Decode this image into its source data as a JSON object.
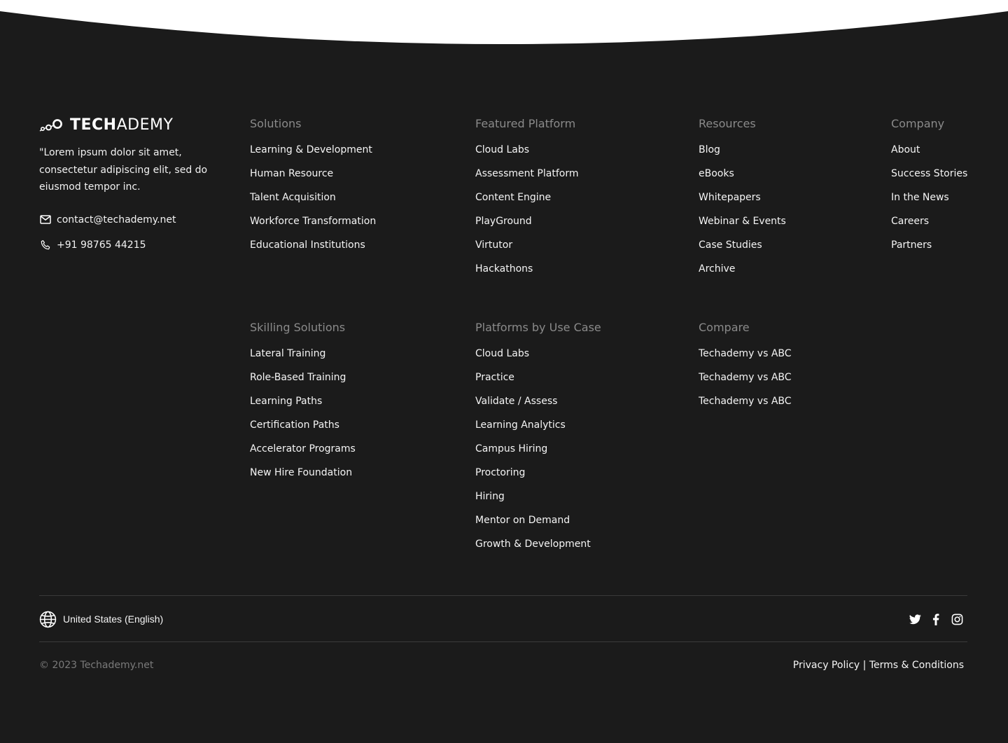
{
  "brand": {
    "logo_bold": "TECH",
    "logo_light": "ADEMY",
    "tagline": "\"Lorem ipsum dolor sit amet, consectetur adipiscing elit, sed do eiusmod tempor inc.",
    "email": "contact@techademy.net",
    "phone": "+91 98765 44215"
  },
  "columns": {
    "solutions": {
      "heading": "Solutions",
      "items": [
        "Learning & Development",
        "Human Resource",
        "Talent Acquisition",
        "Workforce Transformation",
        "Educational Institutions"
      ]
    },
    "featured_platform": {
      "heading": "Featured Platform",
      "items": [
        "Cloud Labs",
        "Assessment Platform",
        "Content Engine",
        "PlayGround",
        "Virtutor",
        "Hackathons"
      ]
    },
    "resources": {
      "heading": "Resources",
      "items": [
        "Blog",
        "eBooks",
        "Whitepapers",
        "Webinar & Events",
        "Case Studies",
        "Archive"
      ]
    },
    "company": {
      "heading": "Company",
      "items": [
        "About",
        "Success Stories",
        "In the News",
        "Careers",
        "Partners"
      ]
    },
    "skilling_solutions": {
      "heading": "Skilling Solutions",
      "items": [
        "Lateral Training",
        "Role-Based Training",
        "Learning Paths",
        "Certification Paths",
        "Accelerator Programs",
        "New Hire Foundation"
      ]
    },
    "platforms_by_use_case": {
      "heading": "Platforms by Use Case",
      "items": [
        "Cloud Labs",
        "Practice",
        "Validate / Assess",
        "Learning Analytics",
        "Campus Hiring",
        "Proctoring",
        "Hiring",
        "Mentor on Demand",
        "Growth & Development"
      ]
    },
    "compare": {
      "heading": "Compare",
      "items": [
        "Techademy vs ABC",
        "Techademy vs ABC",
        "Techademy vs ABC"
      ]
    }
  },
  "footer_bar": {
    "locale": "United States (English)",
    "social_icons": [
      "twitter-icon",
      "facebook-icon",
      "instagram-icon"
    ],
    "copyright": "© 2023 Techademy.net",
    "privacy": "Privacy Policy",
    "separator": "|",
    "terms": "Terms & Conditions"
  },
  "colors": {
    "background": "#1b1b1b",
    "heading": "#8a8a8a",
    "link": "#f5f5f5",
    "divider": "#3a3a3a"
  }
}
